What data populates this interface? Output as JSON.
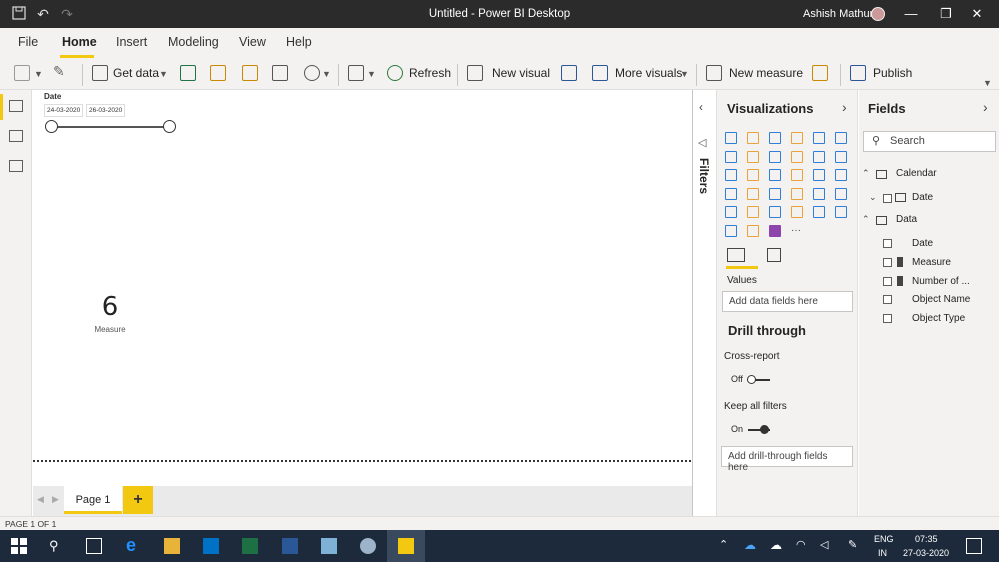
{
  "window": {
    "title": "Untitled - Power BI Desktop",
    "user": "Ashish Mathur"
  },
  "tabs": [
    "File",
    "Home",
    "Insert",
    "Modeling",
    "View",
    "Help"
  ],
  "ribbon": {
    "get_data": "Get data",
    "refresh": "Refresh",
    "new_visual": "New visual",
    "more_visuals": "More visuals",
    "new_measure": "New measure",
    "publish": "Publish"
  },
  "canvas": {
    "slicer": {
      "title": "Date",
      "start": "24-03-2020",
      "end": "26-03-2020"
    },
    "card": {
      "value": "6",
      "label": "Measure"
    }
  },
  "filters": {
    "label": "Filters"
  },
  "visualizations": {
    "title": "Visualizations",
    "values_label": "Values",
    "values_placeholder": "Add data fields here",
    "drill_through": "Drill through",
    "cross_report": "Cross-report",
    "cross_report_state": "Off",
    "keep_all_filters": "Keep all filters",
    "keep_all_filters_state": "On",
    "drill_placeholder": "Add drill-through fields here"
  },
  "fields": {
    "title": "Fields",
    "search_placeholder": "Search",
    "tables": [
      {
        "name": "Calendar",
        "items": [
          "Date"
        ]
      },
      {
        "name": "Data",
        "items": [
          "Date",
          "Measure",
          "Number of ...",
          "Object Name",
          "Object Type"
        ]
      }
    ]
  },
  "pages": {
    "page1": "Page 1",
    "add": "+"
  },
  "status": "PAGE 1 OF 1",
  "taskbar": {
    "lang1": "ENG",
    "lang2": "IN",
    "time": "07:35",
    "date": "27-03-2020"
  },
  "colors": {
    "accent": "#f2c811",
    "titlebar": "#2b2b2b",
    "taskbar": "#1c2a3c"
  }
}
